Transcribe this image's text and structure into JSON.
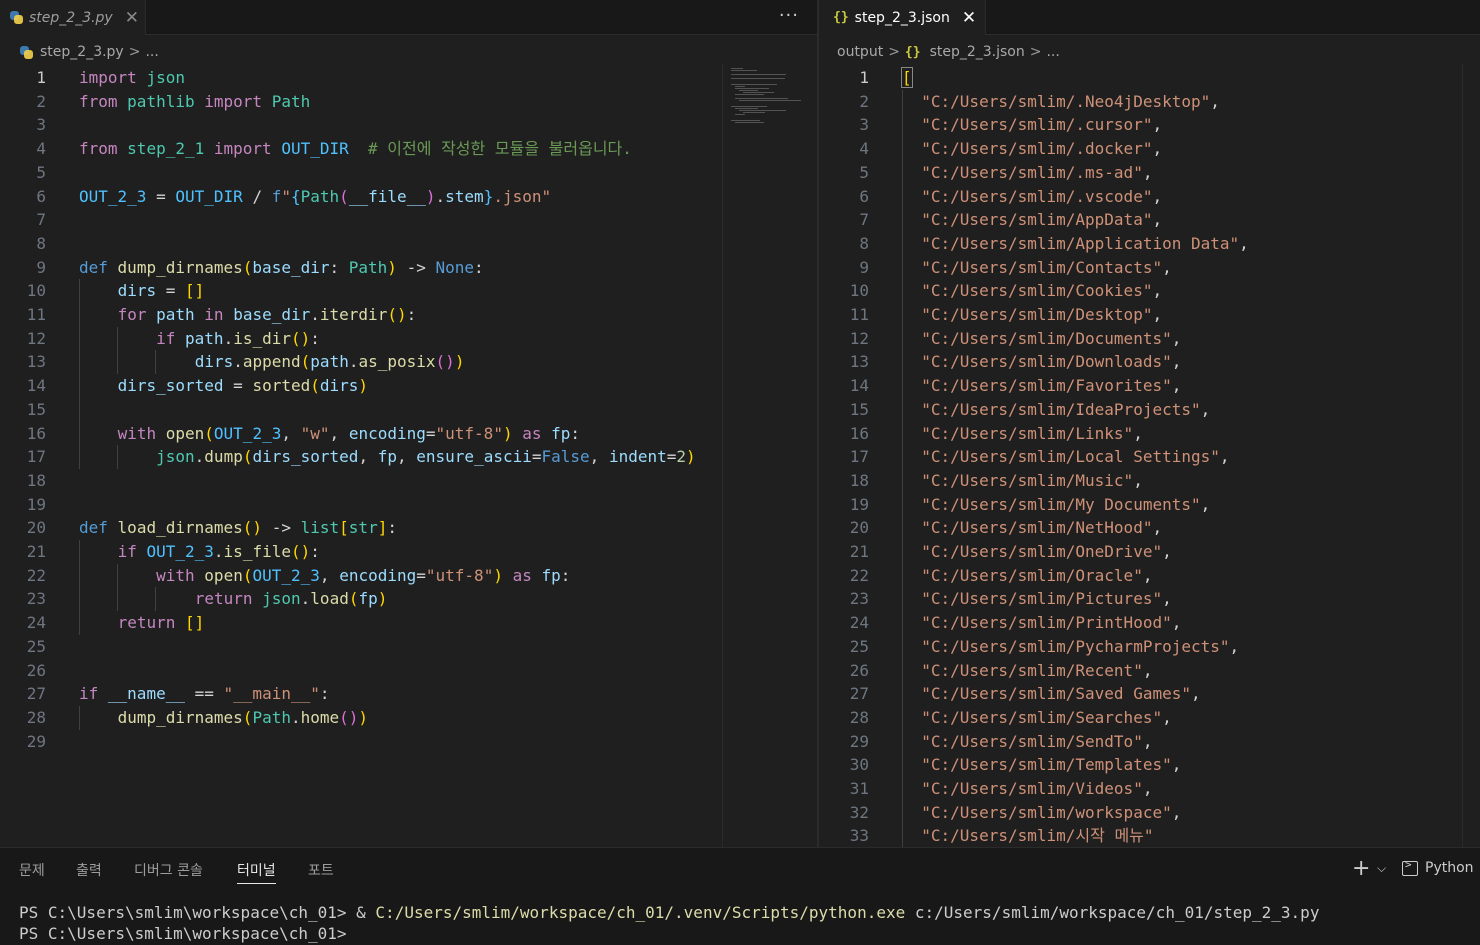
{
  "left_editor": {
    "tab": {
      "file_name": "step_2_3.py",
      "icon": "python-icon",
      "close_icon": "close-icon"
    },
    "more_actions": "···",
    "breadcrumb": {
      "file": "step_2_3.py",
      "separator": ">",
      "ellipsis": "..."
    },
    "active_line": 1,
    "lines": [
      "import json",
      "from pathlib import Path",
      "",
      "from step_2_1 import OUT_DIR  # 이전에 작성한 모듈을 불러옵니다.",
      "",
      "OUT_2_3 = OUT_DIR / f\"{Path(__file__).stem}.json\"",
      "",
      "",
      "def dump_dirnames(base_dir: Path) -> None:",
      "    dirs = []",
      "    for path in base_dir.iterdir():",
      "        if path.is_dir():",
      "            dirs.append(path.as_posix())",
      "    dirs_sorted = sorted(dirs)",
      "",
      "    with open(OUT_2_3, \"w\", encoding=\"utf-8\") as fp:",
      "        json.dump(dirs_sorted, fp, ensure_ascii=False, indent=2)",
      "",
      "",
      "def load_dirnames() -> list[str]:",
      "    if OUT_2_3.is_file():",
      "        with open(OUT_2_3, encoding=\"utf-8\") as fp:",
      "            return json.load(fp)",
      "    return []",
      "",
      "",
      "if __name__ == \"__main__\":",
      "    dump_dirnames(Path.home())",
      ""
    ]
  },
  "right_editor": {
    "tab": {
      "file_name": "step_2_3.json",
      "icon": "json-braces-icon",
      "close_icon": "close-icon"
    },
    "breadcrumb": {
      "folder": "output",
      "file": "step_2_3.json",
      "separator": ">",
      "ellipsis": "..."
    },
    "active_line": 1,
    "lines": [
      "[",
      "  \"C:/Users/smlim/.Neo4jDesktop\",",
      "  \"C:/Users/smlim/.cursor\",",
      "  \"C:/Users/smlim/.docker\",",
      "  \"C:/Users/smlim/.ms-ad\",",
      "  \"C:/Users/smlim/.vscode\",",
      "  \"C:/Users/smlim/AppData\",",
      "  \"C:/Users/smlim/Application Data\",",
      "  \"C:/Users/smlim/Contacts\",",
      "  \"C:/Users/smlim/Cookies\",",
      "  \"C:/Users/smlim/Desktop\",",
      "  \"C:/Users/smlim/Documents\",",
      "  \"C:/Users/smlim/Downloads\",",
      "  \"C:/Users/smlim/Favorites\",",
      "  \"C:/Users/smlim/IdeaProjects\",",
      "  \"C:/Users/smlim/Links\",",
      "  \"C:/Users/smlim/Local Settings\",",
      "  \"C:/Users/smlim/Music\",",
      "  \"C:/Users/smlim/My Documents\",",
      "  \"C:/Users/smlim/NetHood\",",
      "  \"C:/Users/smlim/OneDrive\",",
      "  \"C:/Users/smlim/Oracle\",",
      "  \"C:/Users/smlim/Pictures\",",
      "  \"C:/Users/smlim/PrintHood\",",
      "  \"C:/Users/smlim/PycharmProjects\",",
      "  \"C:/Users/smlim/Recent\",",
      "  \"C:/Users/smlim/Saved Games\",",
      "  \"C:/Users/smlim/Searches\",",
      "  \"C:/Users/smlim/SendTo\",",
      "  \"C:/Users/smlim/Templates\",",
      "  \"C:/Users/smlim/Videos\",",
      "  \"C:/Users/smlim/workspace\",",
      "  \"C:/Users/smlim/시작 메뉴\""
    ]
  },
  "panel": {
    "tabs": [
      "문제",
      "출력",
      "디버그 콘솔",
      "터미널",
      "포트"
    ],
    "active_tab": "터미널",
    "new_terminal": "+",
    "dropdown": "⌵",
    "terminal_name": "Python",
    "terminal": {
      "prompt": "PS C:\\Users\\smlim\\workspace\\ch_01> ",
      "operator": "& ",
      "executable": "C:/Users/smlim/workspace/ch_01/.venv/Scripts/python.exe",
      "argument": " c:/Users/smlim/workspace/ch_01/step_2_3.py",
      "prompt2": "PS C:\\Users\\smlim\\workspace\\ch_01>"
    }
  }
}
